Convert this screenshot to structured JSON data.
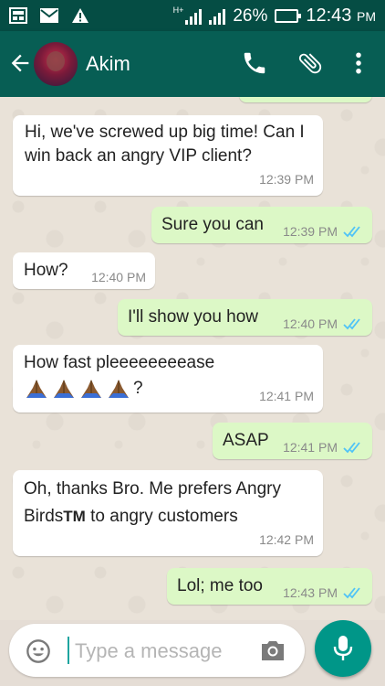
{
  "status_bar": {
    "battery": "26%",
    "time": "12:43",
    "ampm": "PM",
    "network": "H+"
  },
  "header": {
    "contact_name": "Akim"
  },
  "messages": [
    {
      "side": "in",
      "text": "Hi, we've screwed up big time! Can I win back an angry  VIP client?",
      "time": "12:39 PM"
    },
    {
      "side": "out",
      "text": "Sure you can",
      "time": "12:39 PM"
    },
    {
      "side": "in",
      "text": "How?",
      "time": "12:40 PM"
    },
    {
      "side": "out",
      "text": "I'll show you how",
      "time": "12:40 PM"
    },
    {
      "side": "in",
      "text": "How fast pleeeeeeeease",
      "text_suffix": "?",
      "emoji": "folded-hands x4",
      "time": "12:41 PM"
    },
    {
      "side": "out",
      "text": "ASAP",
      "time": "12:41 PM"
    },
    {
      "side": "in",
      "text_a": "Oh, thanks Bro. Me prefers Angry Birds",
      "tm": "TM",
      "text_b": " to angry customers",
      "time": "12:42 PM"
    },
    {
      "side": "out",
      "text": "Lol; me too",
      "time": "12:43 PM"
    }
  ],
  "input": {
    "placeholder": "Type a message"
  },
  "colors": {
    "status_bar": "#054d44",
    "app_bar": "#075e54",
    "outgoing_bubble": "#dcf8c6",
    "incoming_bubble": "#ffffff",
    "read_ticks": "#4fc3f7",
    "mic_button": "#009688"
  },
  "icons": [
    "back-arrow-icon",
    "call-icon",
    "attachment-icon",
    "more-vert-icon",
    "emoji-icon",
    "camera-icon",
    "mic-icon",
    "read-ticks-icon"
  ]
}
